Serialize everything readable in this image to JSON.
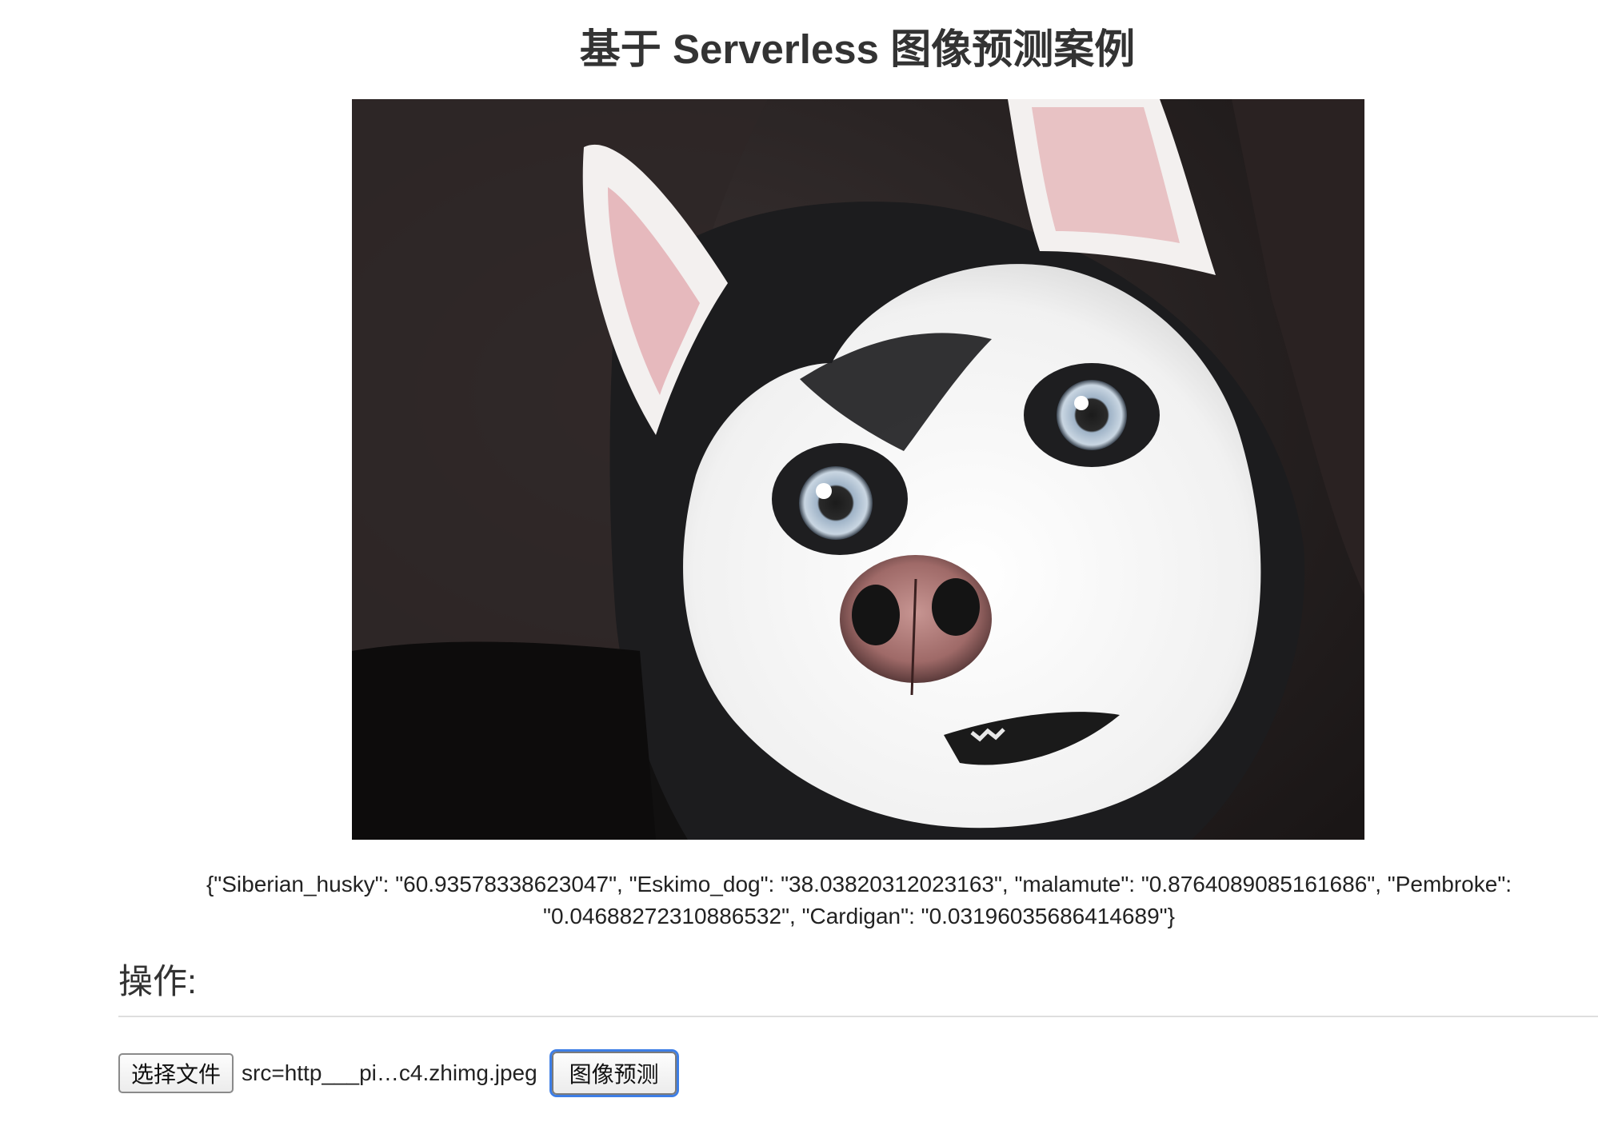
{
  "page": {
    "title": "基于 Serverless 图像预测案例"
  },
  "photo": {
    "subject": "husky-dog-photo"
  },
  "prediction": {
    "result_text": "{\"Siberian_husky\": \"60.93578338623047\", \"Eskimo_dog\": \"38.03820312023163\", \"malamute\": \"0.8764089085161686\", \"Pembroke\": \"0.04688272310886532\", \"Cardigan\": \"0.03196035686414689\"}"
  },
  "operations": {
    "heading": "操作:",
    "choose_file_label": "选择文件",
    "file_name": "src=http___pi…c4.zhimg.jpeg",
    "predict_label": "图像预测"
  },
  "colors": {
    "focus_ring": "#3d7ee6",
    "divider": "#dedede"
  }
}
